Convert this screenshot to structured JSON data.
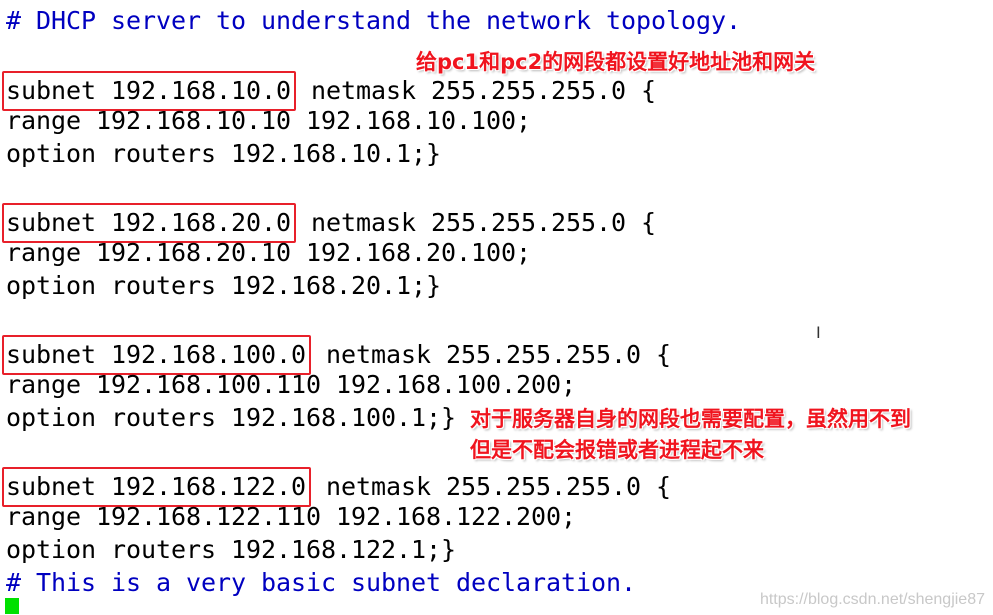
{
  "terminal": {
    "lines": [
      {
        "type": "comment",
        "text": "# DHCP server to understand the network topology."
      },
      {
        "type": "subnet",
        "boxed": "subnet 192.168.10.0",
        "rest": " netmask 255.255.255.0 {"
      },
      {
        "type": "code",
        "text": "range 192.168.10.10 192.168.10.100;"
      },
      {
        "type": "code",
        "text": "option routers 192.168.10.1;}"
      },
      {
        "type": "subnet",
        "boxed": "subnet 192.168.20.0",
        "rest": " netmask 255.255.255.0 {"
      },
      {
        "type": "code",
        "text": "range 192.168.20.10 192.168.20.100;"
      },
      {
        "type": "code",
        "text": "option routers 192.168.20.1;}"
      },
      {
        "type": "subnet",
        "boxed": "subnet 192.168.100.0",
        "rest": " netmask 255.255.255.0 {"
      },
      {
        "type": "code",
        "text": "range 192.168.100.110 192.168.100.200;"
      },
      {
        "type": "code",
        "text": "option routers 192.168.100.1;}"
      },
      {
        "type": "subnet",
        "boxed": "subnet 192.168.122.0",
        "rest": " netmask 255.255.255.0 {"
      },
      {
        "type": "code",
        "text": "range 192.168.122.110 192.168.122.200;"
      },
      {
        "type": "code",
        "text": "option routers 192.168.122.1;}"
      },
      {
        "type": "comment",
        "text": "# This is a very basic subnet declaration."
      }
    ]
  },
  "annotations": {
    "note1": "给pc1和pc2的网段都设置好地址池和网关",
    "note2_line1": "对于服务器自身的网段也需要配置，虽然用不到",
    "note2_line2": "但是不配会报错或者进程起不来"
  },
  "watermark": "https://blog.csdn.net/shengjie87",
  "colors": {
    "comment": "#0000c0",
    "highlight_box": "#e8202a",
    "annotation": "#f0141e",
    "cursor": "#00e000"
  }
}
